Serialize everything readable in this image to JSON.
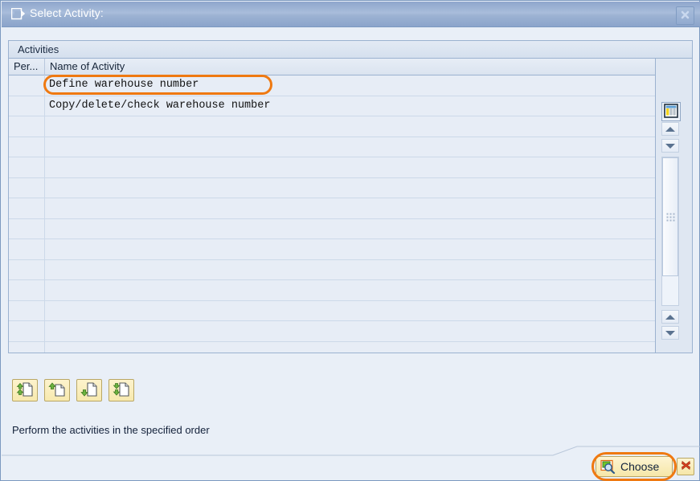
{
  "window": {
    "title": "Select Activity:",
    "title_icon": "dialog-window-icon",
    "close_icon": "close-x-icon",
    "accent_highlight": "#ef7911",
    "titlebar_color": "#9db3d3",
    "body_color": "#e9eff7"
  },
  "table": {
    "group_header": "Activities",
    "columns": [
      {
        "label": "Per...",
        "key": "performed"
      },
      {
        "label": "Name of Activity",
        "key": "name"
      }
    ],
    "rows": [
      {
        "performed": "",
        "name": "Define warehouse number",
        "highlighted": true
      },
      {
        "performed": "",
        "name": "Copy/delete/check warehouse number",
        "highlighted": false
      }
    ],
    "empty_row_count": 12,
    "settings_icon": "table-settings-icon",
    "scroll_up_icon": "triangle-up-icon",
    "scroll_down_icon": "triangle-down-icon",
    "scrollbar_grip": "scrollbar-grip-dots"
  },
  "toolbar": {
    "buttons": [
      {
        "name": "expand-all-button",
        "icon": "document-double-up-arrow-icon"
      },
      {
        "name": "expand-node-button",
        "icon": "document-single-up-arrow-icon"
      },
      {
        "name": "collapse-node-button",
        "icon": "document-single-down-arrow-icon"
      },
      {
        "name": "collapse-all-button",
        "icon": "document-double-down-arrow-icon"
      }
    ]
  },
  "status": {
    "message": "Perform the activities in the specified order"
  },
  "footer": {
    "choose_label": "Choose",
    "choose_icon": "magnifier-select-icon",
    "cancel_icon": "red-x-icon"
  }
}
